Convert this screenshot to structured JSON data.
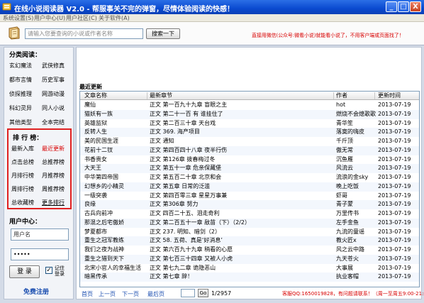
{
  "window": {
    "title": "在线小说阅读器 V2.0 - 帮服事关不完的弹窗，尽情体验阅读的快感！",
    "minimize": "_",
    "maximize": "□",
    "close": "X"
  },
  "menu": [
    "系统设置(S)",
    "用户中心(U)",
    "用户社区(C)",
    "关于软件(A)"
  ],
  "search": {
    "placeholder": "请输入您要查询的小说或作者名称",
    "button": "搜索一下",
    "notice": "直接用微信(公众号:微看小说)就能看小说了，不用客户端或页面找了！"
  },
  "sidebar": {
    "category_title": "分类阅读：",
    "categories": [
      "玄幻魔法",
      "武侠修真",
      "都市言情",
      "历史军事",
      "侦探推理",
      "网游动漫",
      "科幻灵异",
      "同人小说",
      "其他类型",
      "全本完结"
    ],
    "rank_title": "排 行 榜：",
    "ranks": [
      "最新入库",
      "最近更新",
      "点击总榜",
      "总推荐榜",
      "月排行榜",
      "月推荐榜",
      "周排行榜",
      "周推荐榜",
      "总收藏榜",
      "更多排行"
    ],
    "login_title": "用户中心：",
    "username_placeholder": "用户名",
    "password_value": "•••••",
    "login_button": "登 录",
    "remember_label": "记住登录",
    "register_link": "免费注册"
  },
  "main": {
    "heading": "最近更新",
    "columns": [
      "文章名称",
      "最新章节",
      "作者",
      "更新时间"
    ],
    "rows": [
      {
        "name": "魔仙",
        "chapter": "正文 第一百九十九章 盲眼之主",
        "author": "hot",
        "time": "2013-07-19"
      },
      {
        "name": "猫妖有一族",
        "chapter": "正文 第二十一百 有 谁挂住了",
        "author": "燃烧不会熄歌歌",
        "time": "2013-07-19"
      },
      {
        "name": "英雄监狱",
        "chapter": "正文 第二百三十章 天台戏",
        "author": "青华笙",
        "time": "2013-07-19"
      },
      {
        "name": "反转人生",
        "chapter": "正文 369. 海产项目",
        "author": "落寞的嗨皮",
        "time": "2013-07-19"
      },
      {
        "name": "美的民国生涯",
        "chapter": "正文 通知",
        "author": "千斤顶",
        "time": "2013-07-19"
      },
      {
        "name": "花前十二钗",
        "chapter": "正文 第四百四十八章 夜半行伤",
        "author": "傲无常",
        "time": "2013-07-19"
      },
      {
        "name": "书香贵女",
        "chapter": "正文 第126章 拨春梅过冬",
        "author": "沉鱼雁",
        "time": "2013-07-19"
      },
      {
        "name": "大天王",
        "chapter": "正文 第五十一章 危亲保藏堡",
        "author": "风流云",
        "time": "2013-07-19"
      },
      {
        "name": "中华第四帝国",
        "chapter": "正文 第五百二十章 北京和会",
        "author": "流浪的金sky",
        "time": "2013-07-19"
      },
      {
        "name": "幻想乡的小精灵",
        "chapter": "正文 第五章 日常的泛滥",
        "author": "晚上吃饭",
        "time": "2013-07-19"
      },
      {
        "name": "一级突袭",
        "chapter": "正文 第四百零三章 星星万事兼",
        "author": "虾哥",
        "time": "2013-07-19"
      },
      {
        "name": "良缘",
        "chapter": "正文 第306章 努力",
        "author": "青子蒙",
        "time": "2013-07-19"
      },
      {
        "name": "古兵向前冲",
        "chapter": "正文 四百二十五、泪走奇利",
        "author": "万里传书",
        "time": "2013-07-19"
      },
      {
        "name": "那混之后宅傲娇",
        "chapter": "正文 第二百五十一章 敌苗（下）（2/2）",
        "author": "左手金鱼",
        "time": "2013-07-19"
      },
      {
        "name": "梦夏都市",
        "chapter": "正文 237. 明知、暗剑（2）",
        "author": "九流的童谣",
        "time": "2013-07-19"
      },
      {
        "name": "重生之冠军教练",
        "chapter": "正文 58. 五荷、真是‘好消息’",
        "author": "教火匠x",
        "time": "2013-07-19"
      },
      {
        "name": "我们之夜为战神",
        "chapter": "正文 第六百九十九章 稍看的心愿",
        "author": "风之云中路",
        "time": "2013-07-19"
      },
      {
        "name": "重生之猎到天下",
        "chapter": "正文 第七百三十四章 又被人小虎",
        "author": "九天苍火",
        "time": "2013-07-19"
      },
      {
        "name": "北宋小官人的幸福生活",
        "chapter": "正文 第七九二章 诡隐恶山",
        "author": "大事展",
        "time": "2013-07-19"
      },
      {
        "name": "暗黑传承",
        "chapter": "正文 第七章 辞！",
        "author": "执业客帽",
        "time": "2013-07-19"
      }
    ],
    "pager": {
      "first": "首页",
      "prev": "上一页",
      "next": "下一页",
      "last": "最后页",
      "go": "Go",
      "count": "1/2957",
      "notice": "客服QQ:1650019828，有问题请联系！（周一至周五9:00-21:00）"
    }
  }
}
